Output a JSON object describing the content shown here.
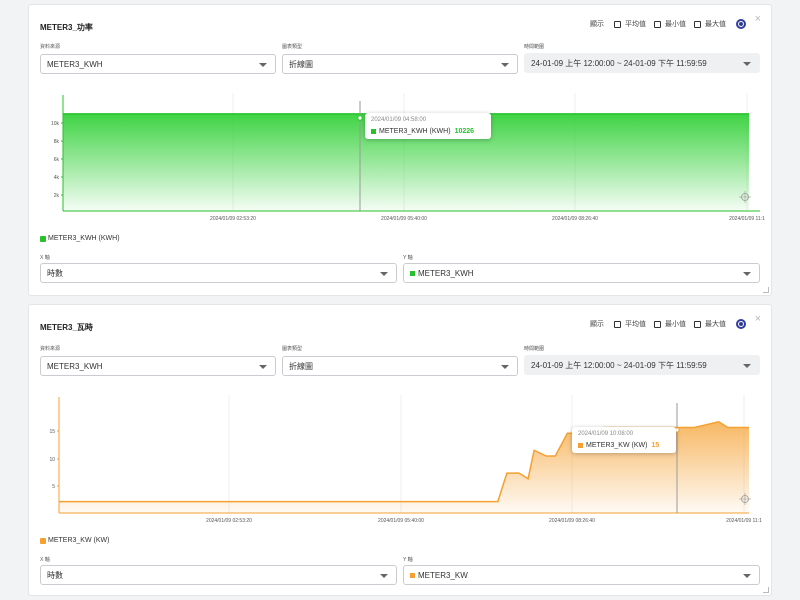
{
  "display_label": "顯示",
  "opt_avg": "平均值",
  "opt_min": "最小值",
  "opt_max": "最大值",
  "label_source": "資料來源",
  "label_type": "圖表類型",
  "label_range": "時間範圍",
  "label_x": "X 軸",
  "label_y": "Y 軸",
  "close_glyph": "×",
  "icons": {
    "close": "close-icon",
    "settings": "gear-icon",
    "reset": "reset-zoom-icon",
    "dropdown": "chevron-down-icon"
  },
  "panels": [
    {
      "title": "METER3_功率",
      "source": "METER3_KWH",
      "chart_type": "折線圖",
      "range": "24-01-09 上午 12:00:00 ~ 24-01-09 下午 11:59:59",
      "legend": "METER3_KWH (KWH)",
      "x_axis": "時數",
      "y_axis": "METER3_KWH",
      "color": "#27c22b",
      "tooltip": {
        "time": "2024/01/09 04:58:00",
        "series": "METER3_KWH (KWH)",
        "value": "10226"
      }
    },
    {
      "title": "METER3_瓦時",
      "source": "METER3_KWH",
      "chart_type": "折線圖",
      "range": "24-01-09 上午 12:00:00 ~ 24-01-09 下午 11:59:59",
      "legend": "METER3_KW (KW)",
      "x_axis": "時數",
      "y_axis": "METER3_KW",
      "color": "#f5a030",
      "tooltip": {
        "time": "2024/01/09 10:08:00",
        "series": "METER3_KW (KW)",
        "value": "15"
      }
    }
  ],
  "chart_data": [
    {
      "type": "area",
      "x_tick_labels": [
        "2024/01/09 02:53:20",
        "2024/01/09 05:40:00",
        "2024/01/09 08:26:40",
        "2024/01/09 11:1"
      ],
      "y_tick_labels": [
        "2k",
        "4k",
        "6k",
        "8k",
        "10k"
      ],
      "ylim": [
        0,
        12000
      ],
      "series": [
        {
          "name": "METER3_KWH (KWH)",
          "x_hours": [
            0,
            4.97,
            24
          ],
          "values": [
            10226,
            10226,
            10226
          ]
        }
      ],
      "grid": true
    },
    {
      "type": "area",
      "x_tick_labels": [
        "2024/01/09 02:53:20",
        "2024/01/09 05:40:00",
        "2024/01/09 08:26:40",
        "2024/01/09 11:1"
      ],
      "y_tick_labels": [
        "5",
        "10",
        "15"
      ],
      "ylim": [
        0,
        20
      ],
      "series": [
        {
          "name": "METER3_KW (KW)",
          "x_hours": [
            0,
            7.25,
            7.4,
            7.6,
            7.75,
            7.85,
            8.05,
            8.2,
            8.4,
            8.5,
            9.0,
            10.13,
            10.5,
            10.9,
            11.05,
            11.2
          ],
          "values": [
            2,
            2,
            7,
            7,
            6,
            11,
            10,
            10,
            14,
            14,
            15,
            15,
            15,
            16,
            15,
            15
          ]
        }
      ],
      "grid": true
    }
  ]
}
